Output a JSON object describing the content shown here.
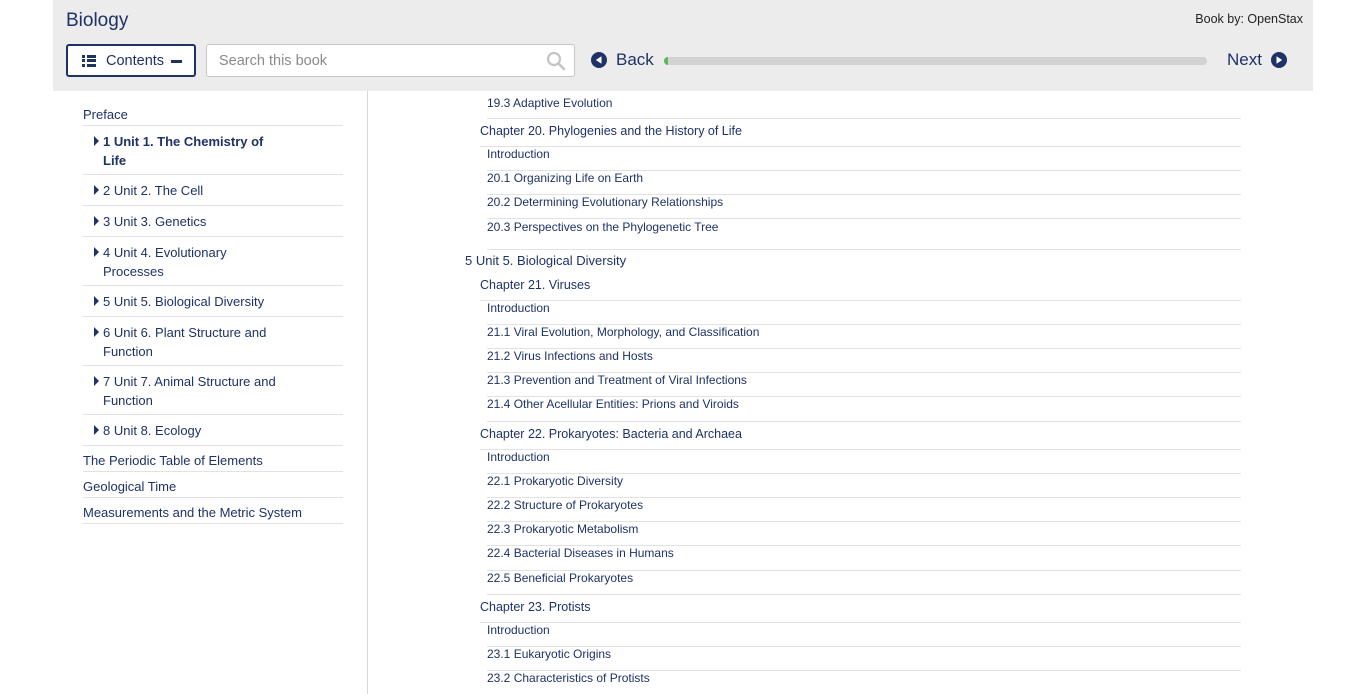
{
  "header": {
    "title": "Biology",
    "book_by": "Book by: OpenStax",
    "contents_label": "Contents",
    "search_placeholder": "Search this book",
    "back_label": "Back",
    "next_label": "Next",
    "progress_percent": 0.5,
    "accent_color": "#1e3266",
    "progress_color": "#5cb85c"
  },
  "sidebar": {
    "items": [
      {
        "label": "Preface",
        "type": "plain"
      },
      {
        "label": "1 Unit 1. The Chemistry of Life",
        "type": "unit",
        "bold": true
      },
      {
        "label": "2 Unit 2. The Cell",
        "type": "unit"
      },
      {
        "label": "3 Unit 3. Genetics",
        "type": "unit"
      },
      {
        "label": "4 Unit 4. Evolutionary Processes",
        "type": "unit"
      },
      {
        "label": "5 Unit 5. Biological Diversity",
        "type": "unit"
      },
      {
        "label": "6 Unit 6. Plant Structure and Function",
        "type": "unit"
      },
      {
        "label": "7 Unit 7. Animal Structure and Function",
        "type": "unit"
      },
      {
        "label": "8 Unit 8. Ecology",
        "type": "unit"
      },
      {
        "label": "The Periodic Table of Elements",
        "type": "plain"
      },
      {
        "label": "Geological Time",
        "type": "plain"
      },
      {
        "label": "Measurements and the Metric System",
        "type": "plain"
      }
    ]
  },
  "toc": {
    "rows": [
      {
        "label": "19.3 Adaptive Evolution",
        "level": "section"
      },
      {
        "label": "Chapter 20. Phylogenies and the History of Life",
        "level": "chapter"
      },
      {
        "label": "Introduction",
        "level": "section"
      },
      {
        "label": "20.1 Organizing Life on Earth",
        "level": "section"
      },
      {
        "label": "20.2 Determining Evolutionary Relationships",
        "level": "section"
      },
      {
        "label": "20.3 Perspectives on the Phylogenetic Tree",
        "level": "section"
      },
      {
        "label": "5 Unit 5. Biological Diversity",
        "level": "unit"
      },
      {
        "label": "Chapter 21. Viruses",
        "level": "chapter"
      },
      {
        "label": "Introduction",
        "level": "section"
      },
      {
        "label": "21.1 Viral Evolution, Morphology, and Classification",
        "level": "section"
      },
      {
        "label": "21.2 Virus Infections and Hosts",
        "level": "section"
      },
      {
        "label": "21.3 Prevention and Treatment of Viral Infections",
        "level": "section"
      },
      {
        "label": "21.4 Other Acellular Entities: Prions and Viroids",
        "level": "section"
      },
      {
        "label": "Chapter 22. Prokaryotes: Bacteria and Archaea",
        "level": "chapter"
      },
      {
        "label": "Introduction",
        "level": "section"
      },
      {
        "label": "22.1 Prokaryotic Diversity",
        "level": "section"
      },
      {
        "label": "22.2 Structure of Prokaryotes",
        "level": "section"
      },
      {
        "label": "22.3 Prokaryotic Metabolism",
        "level": "section"
      },
      {
        "label": "22.4 Bacterial Diseases in Humans",
        "level": "section"
      },
      {
        "label": "22.5 Beneficial Prokaryotes",
        "level": "section"
      },
      {
        "label": "Chapter 23. Protists",
        "level": "chapter"
      },
      {
        "label": "Introduction",
        "level": "section"
      },
      {
        "label": "23.1 Eukaryotic Origins",
        "level": "section"
      },
      {
        "label": "23.2 Characteristics of Protists",
        "level": "section"
      }
    ]
  }
}
